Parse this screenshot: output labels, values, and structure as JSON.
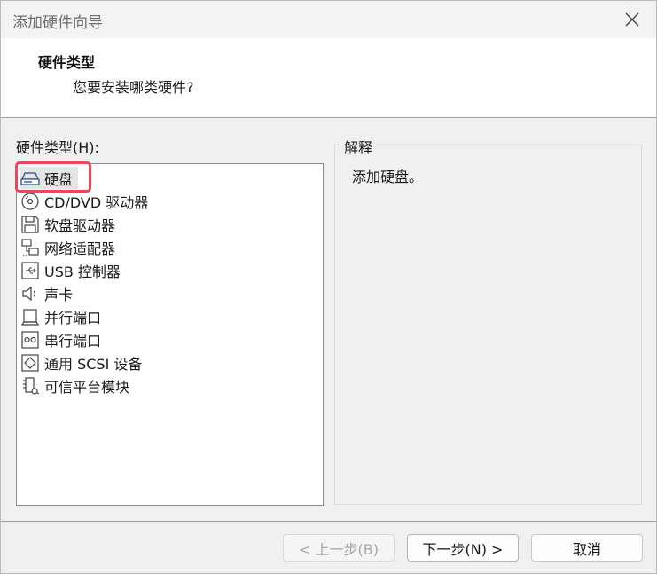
{
  "window": {
    "title": "添加硬件向导"
  },
  "header": {
    "title": "硬件类型",
    "subtitle": "您要安装哪类硬件?"
  },
  "hardware_list": {
    "label": "硬件类型(H):",
    "selected": "硬盘",
    "items": [
      {
        "label": "硬盘",
        "icon": "hard-disk-icon"
      },
      {
        "label": "CD/DVD 驱动器",
        "icon": "cd-dvd-icon"
      },
      {
        "label": "软盘驱动器",
        "icon": "floppy-icon"
      },
      {
        "label": "网络适配器",
        "icon": "network-adapter-icon"
      },
      {
        "label": "USB 控制器",
        "icon": "usb-icon"
      },
      {
        "label": "声卡",
        "icon": "speaker-icon"
      },
      {
        "label": "并行端口",
        "icon": "parallel-port-icon"
      },
      {
        "label": "串行端口",
        "icon": "serial-port-icon"
      },
      {
        "label": "通用 SCSI 设备",
        "icon": "scsi-icon"
      },
      {
        "label": "可信平台模块",
        "icon": "tpm-icon"
      }
    ]
  },
  "explanation": {
    "label": "解释",
    "text": "添加硬盘。"
  },
  "footer": {
    "back_label": "< 上一步(B)",
    "next_label": "下一步(N) >",
    "cancel_label": "取消"
  },
  "colors": {
    "highlight": "#e94a5a",
    "selection": "#e5e5e5"
  }
}
